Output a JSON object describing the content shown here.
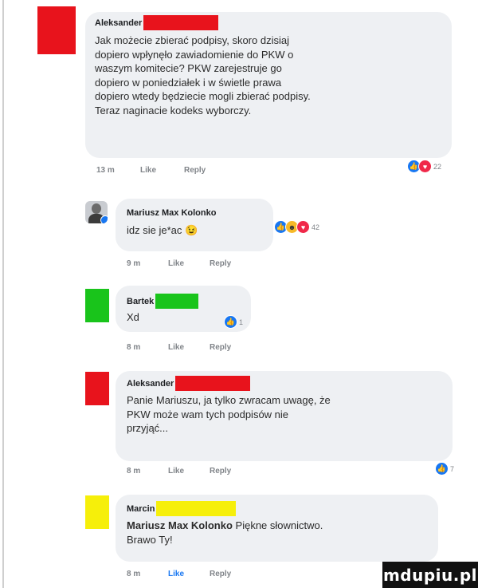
{
  "comments": [
    {
      "author": "Aleksander",
      "text_lines": [
        "Jak możecie zbierać podpisy, skoro dzisiaj",
        "dopiero wpłynęło zawiadomienie do PKW o",
        "waszym komitecie? PKW zarejestruje go",
        "dopiero w poniedziałek i w świetle prawa",
        "dopiero wtedy będziecie mogli zbierać podpisy.",
        "Teraz naginacie kodeks wyborczy."
      ],
      "time": "13 m",
      "like": "Like",
      "reply": "Reply",
      "reaction_count": "22",
      "avatar_color": "#e8131c",
      "redact_color": "#e8131c"
    },
    {
      "author": "Mariusz Max Kolonko",
      "text_lines": [
        "idz sie je*ac 😉"
      ],
      "time": "9 m",
      "like": "Like",
      "reply": "Reply",
      "reaction_count": "42"
    },
    {
      "author": "Bartek",
      "text_lines": [
        "Xd"
      ],
      "time": "8 m",
      "like": "Like",
      "reply": "Reply",
      "reaction_count": "1",
      "avatar_color": "#19c41b",
      "redact_color": "#19c41b"
    },
    {
      "author": "Aleksander",
      "text_lines": [
        "Panie Mariuszu, ja tylko zwracam uwagę, że",
        "PKW może wam tych podpisów nie",
        "przyjąć..."
      ],
      "time": "8 m",
      "like": "Like",
      "reply": "Reply",
      "reaction_count": "7",
      "avatar_color": "#e8131c",
      "redact_color": "#e8131c"
    },
    {
      "author": "Marcin",
      "mention": "Mariusz Max Kolonko",
      "text_lines": [
        " Piękne słownictwo.",
        "Brawo Ty!"
      ],
      "time": "8 m",
      "like": "Like",
      "reply": "Reply",
      "avatar_color": "#f6ef0a",
      "redact_color": "#f6ef0a"
    }
  ],
  "colors": {
    "like_blue": "#1877f2",
    "love_red": "#f02849",
    "haha_yellow": "#f7b928"
  },
  "watermark": "mdupiu.pl"
}
